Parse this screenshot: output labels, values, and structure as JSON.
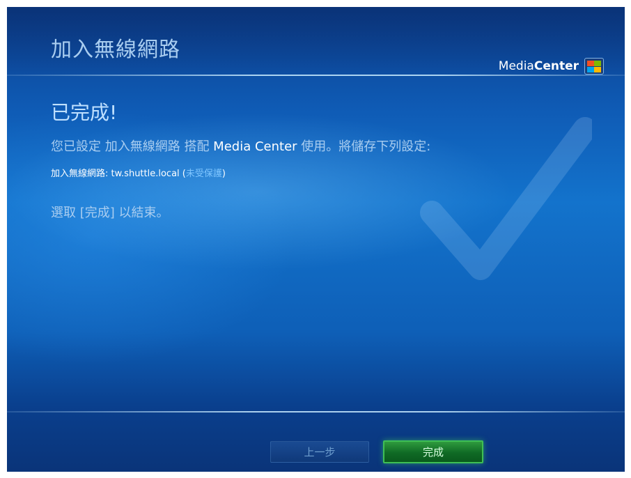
{
  "header": {
    "title": "加入無線網路",
    "logo_prefix": "Media",
    "logo_bold": "Center",
    "logo_icon": "windows-flag-icon"
  },
  "main": {
    "heading": "已完成!",
    "summary_prefix": "您已設定 加入無線網路 搭配 ",
    "summary_highlight": "Media Center",
    "summary_suffix": " 使用。將儲存下列設定:",
    "setting_label": "加入無線網路: tw.shuttle.local (",
    "setting_status": "未受保護",
    "setting_end": ")",
    "instruction": "選取 [完成] 以結束。",
    "watermark_icon": "checkmark-icon"
  },
  "footer": {
    "back_label": "上一步",
    "finish_label": "完成"
  },
  "colors": {
    "accent": "#2f9a3e",
    "background": "#0f5bb5",
    "text": "#a9cdf0"
  }
}
